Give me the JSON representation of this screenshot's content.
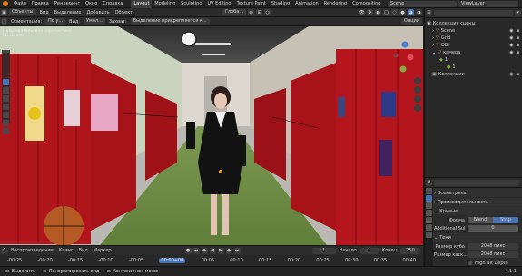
{
  "topbar": {
    "menu": [
      "Файл",
      "Правка",
      "Рендеринг",
      "Окно",
      "Справка"
    ],
    "workspaces": [
      "Layout",
      "Modeling",
      "Sculpting",
      "UV Editing",
      "Texture Paint",
      "Shading",
      "Animation",
      "Rendering",
      "Compositing"
    ],
    "scene": "Scene",
    "view_layer": "ViewLayer"
  },
  "viewport_header": {
    "mode": "Объекты",
    "menus": [
      "Вид",
      "Выделение",
      "Добавить",
      "Объект"
    ],
    "transform": "Глоба..."
  },
  "viewport_header2": {
    "orientation_label": "Ориентация:",
    "orientation_value": "По у...",
    "view_label": "Вид:",
    "view_value": "Умол...",
    "snap_label": "Захват:",
    "snap_value": "Выделение прикрепляется к...",
    "options": "Опции"
  },
  "viewport": {
    "overlay_text_1": "Пользовательская перспектива",
    "overlay_text_2": "(1) Объект"
  },
  "timeline": {
    "menus": [
      "Воспроизведение",
      "Кеинг",
      "Вид",
      "Маркер"
    ],
    "current_frame": "1",
    "start_label": "Начало",
    "start_value": "1",
    "end_label": "Конец",
    "end_value": "250",
    "ticks": [
      "-00:25",
      "-00:20",
      "-00:15",
      "-00:10",
      "-00:05",
      "00:00+00",
      "00:05",
      "00:10",
      "00:15",
      "00:20",
      "00:25",
      "00:30",
      "00:35",
      "00:40"
    ]
  },
  "outliner": {
    "search_placeholder": "",
    "items": [
      {
        "label": "Коллекция сцены",
        "indent": 0
      },
      {
        "label": "Scene",
        "indent": 1
      },
      {
        "label": "Grid",
        "indent": 1
      },
      {
        "label": "OBJ",
        "indent": 1
      },
      {
        "label": "камера",
        "indent": 1
      },
      {
        "label": "1",
        "indent": 2
      },
      {
        "label": "1",
        "indent": 3
      },
      {
        "label": "Коллекции",
        "indent": 1
      }
    ]
  },
  "properties": {
    "search_placeholder": "",
    "panels": [
      "Всеметрика",
      "Производительность",
      "Кривые"
    ],
    "form_label": "Форма",
    "form_opt_1": "Бlend",
    "form_opt_2": "Strip",
    "additional_label": "Additional Sub...",
    "additional_value": "0",
    "shadows_panel": "Тени",
    "cube_size_label": "Размер куба",
    "cube_size_value": "2048 пикс",
    "cascade_size_label": "Размер каск...",
    "cascade_size_value": "2048 пикс",
    "high_bit_label": "High Bit Depth"
  },
  "statusbar": {
    "left_1": "Выделить",
    "left_2": "Панорамировать вид",
    "left_3": "Контекстное меню",
    "right": "4.1.1"
  }
}
